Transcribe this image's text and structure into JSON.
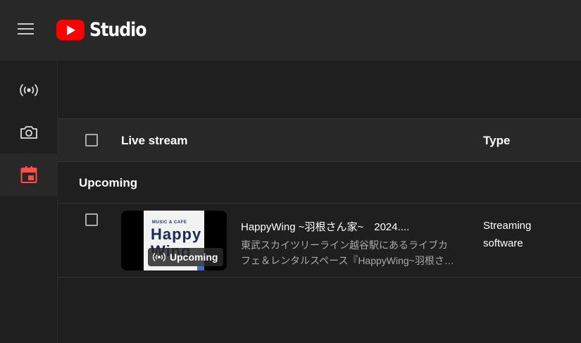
{
  "app": {
    "logo_text": "Studio"
  },
  "sidebar": {
    "items": [
      {
        "icon": "live-broadcast-icon",
        "active": false
      },
      {
        "icon": "camera-icon",
        "active": false
      },
      {
        "icon": "calendar-icon",
        "active": true
      }
    ]
  },
  "table": {
    "columns": {
      "live_stream": "Live stream",
      "type": "Type"
    },
    "sections": [
      {
        "label": "Upcoming",
        "rows": [
          {
            "thumbnail": {
              "art_small": "MUSIC & CAFE",
              "art_line1": "Happy",
              "art_line2": "Wing",
              "badge": "Upcoming"
            },
            "title": "HappyWing ~羽根さん家~　2024....",
            "description_line1": "東武スカイツリーライン越谷駅にあるライブカ",
            "description_line2": "フェ＆レンタルスペース『HappyWing~羽根さ…",
            "type_line1": "Streaming",
            "type_line2": "software"
          }
        ]
      }
    ]
  },
  "colors": {
    "brand_red": "#ff0000",
    "active_icon": "#ff4e45",
    "background": "#1f1f1f",
    "panel": "#282828"
  }
}
